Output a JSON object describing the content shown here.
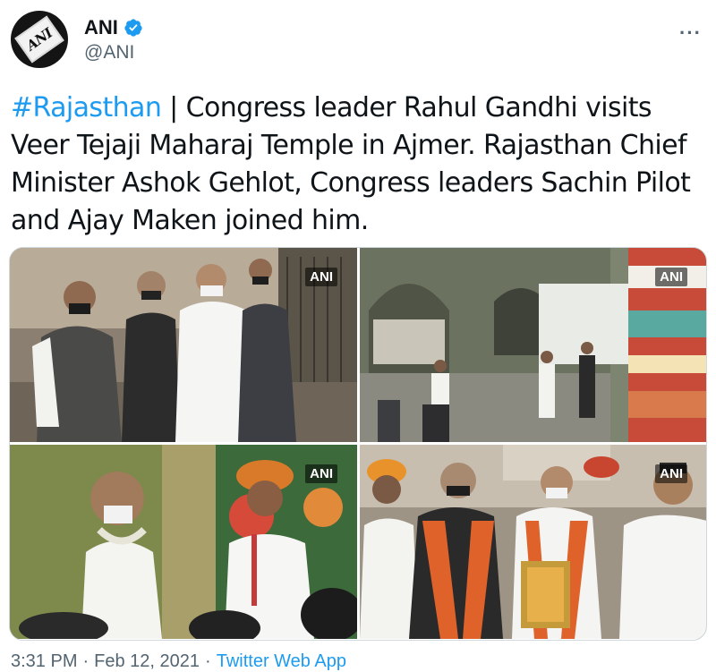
{
  "author": {
    "name": "ANI",
    "handle": "@ANI",
    "avatar_label": "ANI",
    "verified_icon": "verified-badge-icon",
    "verified_color": "#1d9bf0"
  },
  "more_label": "···",
  "tweet": {
    "hashtag": "#Rajasthan",
    "body": " | Congress leader Rahul Gandhi visits Veer Tejaji Maharaj Temple in Ajmer. Rajasthan Chief Minister Ashok Gehlot, Congress leaders Sachin Pilot and Ajay Maken joined him."
  },
  "media": {
    "watermarks": [
      "ANI",
      "ANI",
      "ANI",
      "ANI"
    ]
  },
  "footer": {
    "time": "3:31 PM",
    "separator": "·",
    "date": "Feb 12, 2021",
    "source": "Twitter Web App"
  },
  "colors": {
    "hashtag": "#1d9bf0",
    "text": "#0f1419",
    "secondary": "#536471"
  }
}
